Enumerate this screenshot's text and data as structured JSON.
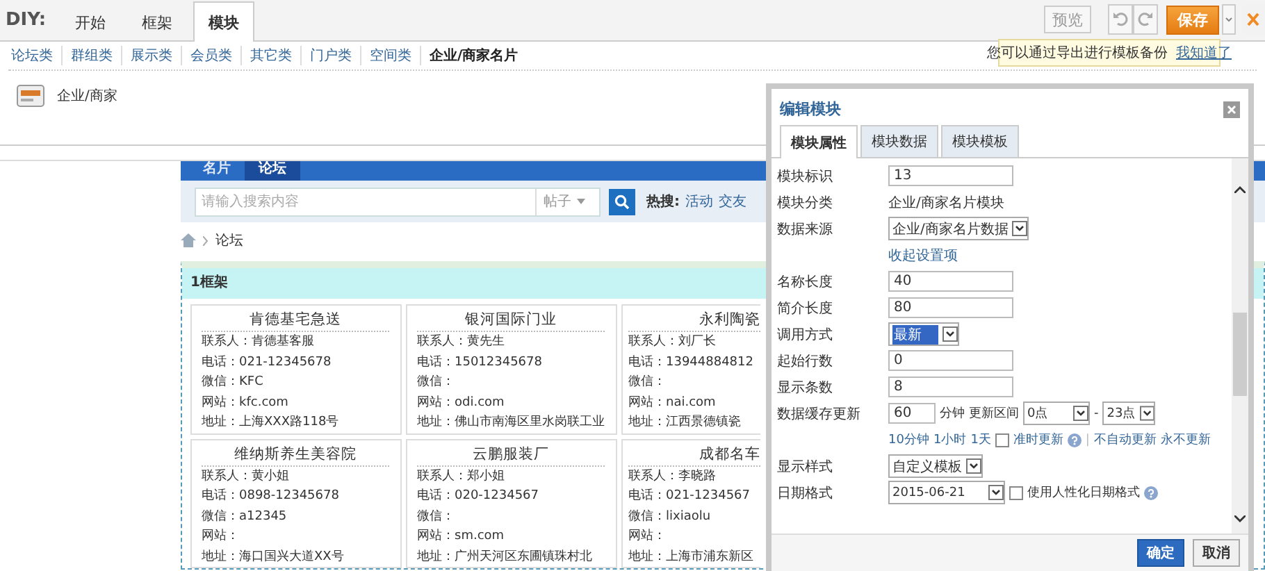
{
  "toolbar": {
    "brand": "DIY:",
    "tabs": [
      {
        "label": "开始",
        "selected": false
      },
      {
        "label": "框架",
        "selected": false
      },
      {
        "label": "模块",
        "selected": true
      }
    ],
    "preview": "预览",
    "save": "保存"
  },
  "tooltip": {
    "text": "您可以通过导出进行模板备份",
    "link": "我知道了"
  },
  "categories": [
    {
      "label": "论坛类",
      "selected": false
    },
    {
      "label": "群组类",
      "selected": false
    },
    {
      "label": "展示类",
      "selected": false
    },
    {
      "label": "会员类",
      "selected": false
    },
    {
      "label": "其它类",
      "selected": false
    },
    {
      "label": "门户类",
      "selected": false
    },
    {
      "label": "空间类",
      "selected": false
    },
    {
      "label": "企业/商家名片",
      "selected": true
    }
  ],
  "modules": [
    "企业/商家"
  ],
  "page": {
    "nav": [
      {
        "label": "名片",
        "selected": false
      },
      {
        "label": "论坛",
        "selected": true
      }
    ],
    "search": {
      "placeholder": "请输入搜索内容",
      "type": "帖子",
      "hot_label": "热搜:",
      "hot": [
        "活动",
        "交友"
      ]
    },
    "breadcrumb": "论坛",
    "frame_title": "1框架",
    "cards": [
      {
        "title": "肯德基宅急送",
        "lines": [
          "联系人：肯德基客服",
          "电话：021-12345678",
          "微信：KFC",
          "网站：kfc.com",
          "地址：上海XXX路118号"
        ]
      },
      {
        "title": "银河国际门业",
        "lines": [
          "联系人：黄先生",
          "电话：15012345678",
          "微信：",
          "网站：odi.com",
          "地址：佛山市南海区里水岗联工业"
        ]
      },
      {
        "title": "永利陶瓷",
        "lines": [
          "联系人：刘厂长",
          "电话：13944884812",
          "微信：",
          "网站：nai.com",
          "地址：江西景德镇瓷"
        ]
      },
      {
        "title": "维纳斯养生美容院",
        "lines": [
          "联系人：黄小姐",
          "电话：0898-12345678",
          "微信：a12345",
          "网站：",
          "地址：海口国兴大道XX号"
        ]
      },
      {
        "title": "云鹏服装厂",
        "lines": [
          "联系人：郑小姐",
          "电话：020-1234567",
          "微信：",
          "网站：sm.com",
          "地址：广州天河区东圃镇珠村北"
        ]
      },
      {
        "title": "成都名车",
        "lines": [
          "联系人：李晓路",
          "电话：021-1234567",
          "微信：lixiaolu",
          "网站：",
          "地址：上海市浦东新区"
        ]
      }
    ]
  },
  "dialog": {
    "title": "编辑模块",
    "tabs": [
      {
        "label": "模块属性",
        "selected": true
      },
      {
        "label": "模块数据",
        "selected": false
      },
      {
        "label": "模块模板",
        "selected": false
      }
    ],
    "rows": [
      {
        "kind": "text",
        "label": "模块标识",
        "value": "13"
      },
      {
        "kind": "static",
        "label": "模块分类",
        "value": "企业/商家名片模块"
      },
      {
        "kind": "select",
        "label": "数据来源",
        "value": "企业/商家名片数据",
        "highlighted": false
      },
      {
        "kind": "link",
        "text": "收起设置项"
      },
      {
        "kind": "text",
        "label": "名称长度",
        "value": "40"
      },
      {
        "kind": "text",
        "label": "简介长度",
        "value": "80"
      },
      {
        "kind": "select",
        "label": "调用方式",
        "value": "最新",
        "highlighted": true
      },
      {
        "kind": "text",
        "label": "起始行数",
        "value": "0"
      },
      {
        "kind": "text",
        "label": "显示条数",
        "value": "8"
      },
      {
        "kind": "cache",
        "label": "数据缓存更新",
        "value": "60",
        "unit": "分钟",
        "range_label": "更新区间",
        "from": "0点",
        "separator": "-",
        "to": "23点",
        "presets": [
          "10分钟",
          "1小时",
          "1天"
        ],
        "ontime": {
          "label": "准时更新",
          "checked": false
        },
        "divider": "|",
        "links": [
          "不自动更新",
          "永不更新"
        ]
      },
      {
        "kind": "select",
        "label": "显示样式",
        "value": "自定义模板",
        "highlighted": false
      },
      {
        "kind": "date",
        "label": "日期格式",
        "value": "2015-06-21",
        "option": {
          "label": "使用人性化日期格式",
          "checked": false
        }
      }
    ],
    "buttons": [
      {
        "label": "确定",
        "primary": true
      },
      {
        "label": "取消",
        "primary": false
      }
    ]
  }
}
